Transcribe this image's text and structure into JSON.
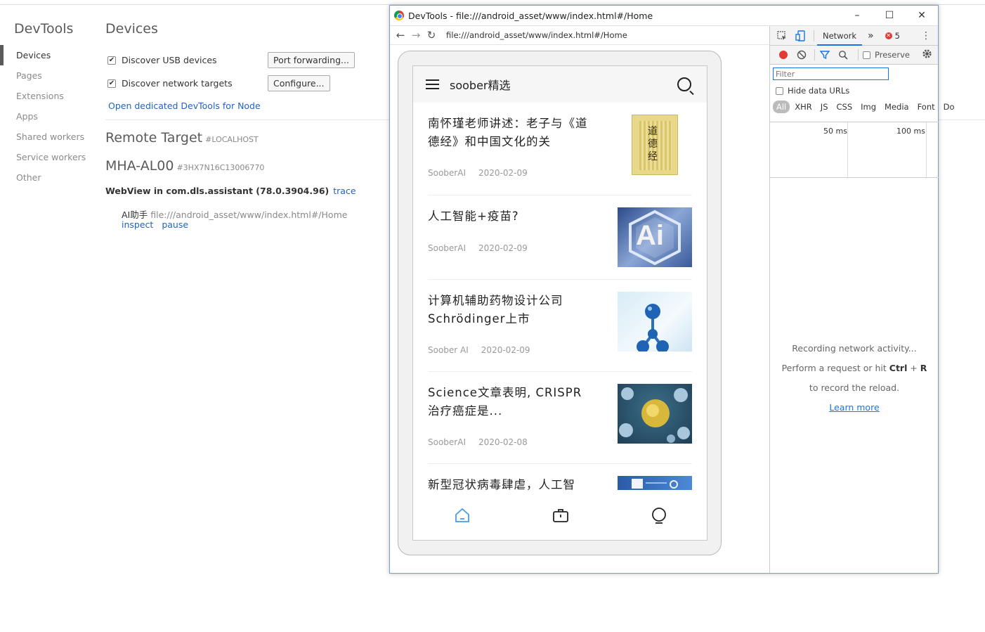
{
  "inspect": {
    "title": "DevTools",
    "nav": [
      "Devices",
      "Pages",
      "Extensions",
      "Apps",
      "Shared workers",
      "Service workers",
      "Other"
    ],
    "section_title": "Devices",
    "discover_usb_label": "Discover USB devices",
    "discover_network_label": "Discover network targets",
    "port_forwarding_label": "Port forwarding...",
    "configure_label": "Configure...",
    "node_link": "Open dedicated DevTools for Node",
    "remote_title": "Remote Target",
    "remote_host": "#LOCALHOST",
    "device_name": "MHA-AL00",
    "device_serial": "#3HX7N16C13006770",
    "webview_label": "WebView in com.dls.assistant (78.0.3904.96)",
    "trace_link": "trace",
    "target_name": "AI助手",
    "target_url": "file:///android_asset/www/index.html#/Home",
    "inspect_link": "inspect",
    "pause_link": "pause"
  },
  "window": {
    "title": "DevTools - file:///android_asset/www/index.html#/Home",
    "minimize": "–",
    "maximize": "☐",
    "close": "✕",
    "url": "file:///android_asset/www/index.html#/Home"
  },
  "app": {
    "title": "soober精选",
    "articles": [
      {
        "title": "南怀瑾老师讲述：老子与《道德经》和中国文化的关",
        "source": "SooberAI",
        "date": "2020-02-09"
      },
      {
        "title": "人工智能+疫苗?",
        "source": "SooberAI",
        "date": "2020-02-09"
      },
      {
        "title": "计算机辅助药物设计公司Schrödinger上市",
        "source": "Soober AI",
        "date": "2020-02-09"
      },
      {
        "title": "Science文章表明, CRISPR治疗癌症是...",
        "source": "SooberAI",
        "date": "2020-02-08"
      },
      {
        "title": "新型冠状病毒肆虐，人工智",
        "source": "",
        "date": ""
      }
    ],
    "thumb_book_text": "道德经",
    "thumb_ai_text": "Ai"
  },
  "devtools": {
    "network_tab": "Network",
    "more_tabs": "»",
    "error_count": "5",
    "preserve_label": "Preserve",
    "filter_placeholder": "Filter",
    "hide_data_urls": "Hide data URLs",
    "types": [
      "All",
      "XHR",
      "JS",
      "CSS",
      "Img",
      "Media",
      "Font",
      "Do"
    ],
    "tick_50": "50 ms",
    "tick_100": "100 ms",
    "msg_line1": "Recording network activity...",
    "msg_line2_a": "Perform a request or hit ",
    "msg_line2_b": "Ctrl",
    "msg_line2_c": " + ",
    "msg_line2_d": "R",
    "msg_line3": "to record the reload.",
    "learn_more": "Learn more"
  }
}
